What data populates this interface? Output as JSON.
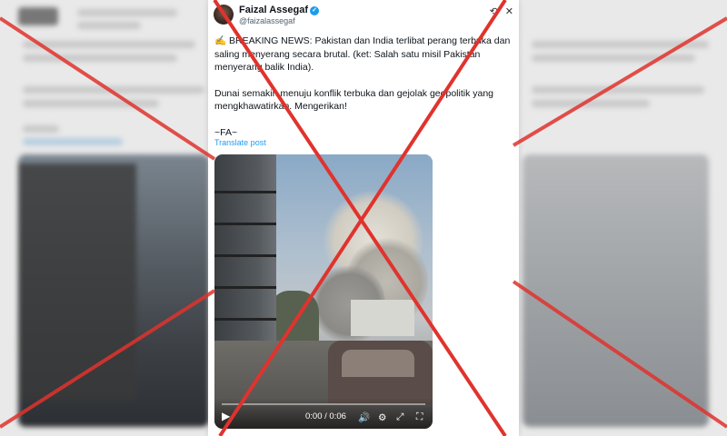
{
  "post": {
    "author_name": "Faizal Assegaf",
    "author_handle": "@faizalassegaf",
    "verified_badge": "verified-badge",
    "paragraph_1": "✍️ BREAKING NEWS: Pakistan dan India terlibat perang terbuka dan saling menyerang secara brutal. (ket: Salah satu misil Pakistan menyerang balik India).",
    "paragraph_2": "Dunai semakin menuju konflik terbuka dan gejolak geopolitik yang mengkhawatirkan. Mengerikan!",
    "signature": "~FA~",
    "translate_label": "Translate post"
  },
  "video": {
    "time_display": "0:00 / 0:06",
    "progress": 0.0
  },
  "icons": {
    "header": [
      "grok-icon",
      "close-icon"
    ],
    "player": [
      "play-icon",
      "volume-icon",
      "settings-icon",
      "fullscreen-icon",
      "expand-icon"
    ]
  },
  "colors": {
    "accent": "#1d9bf0",
    "overlay_cross": "#e0332d"
  }
}
